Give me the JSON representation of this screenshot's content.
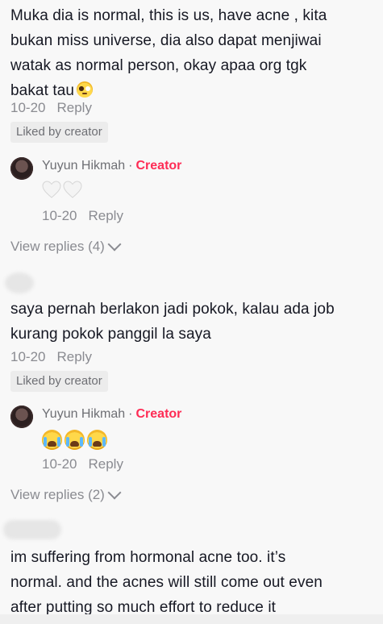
{
  "comments": [
    {
      "text_lines": [
        "Muka dia is normal, this is us, have acne , kita",
        "bukan miss universe, dia also dapat menjiwai",
        "watak as normal person, okay apaa org tgk",
        "bakat tau"
      ],
      "emoji": "pleading-face-icon",
      "date": "10-20",
      "reply": "Reply",
      "liked": "Liked by creator",
      "creator_reply": {
        "name": "Yuyun Hikmah",
        "separator": "·",
        "badge": "Creator",
        "emojis": [
          "white-heart-icon",
          "white-heart-icon"
        ],
        "date": "10-20",
        "reply": "Reply"
      },
      "view_replies": "View replies (4)"
    },
    {
      "text_lines": [
        "saya pernah berlakon jadi pokok, kalau ada job",
        "kurang pokok panggil la saya"
      ],
      "date": "10-20",
      "reply": "Reply",
      "liked": "Liked by creator",
      "creator_reply": {
        "name": "Yuyun Hikmah",
        "separator": "·",
        "badge": "Creator",
        "emojis": [
          "crying-face-icon",
          "crying-face-icon",
          "crying-face-icon"
        ],
        "date": "10-20",
        "reply": "Reply"
      },
      "view_replies": "View replies (2)"
    },
    {
      "text_lines": [
        "im suffering from hormonal acne too. it’s",
        "normal. and the acnes will still come out even",
        "after putting so much effort to reduce it"
      ]
    }
  ],
  "colors": {
    "creator_badge": "#fe2c55",
    "meta_text": "#8a8b91",
    "background": "#f8f8f8"
  }
}
